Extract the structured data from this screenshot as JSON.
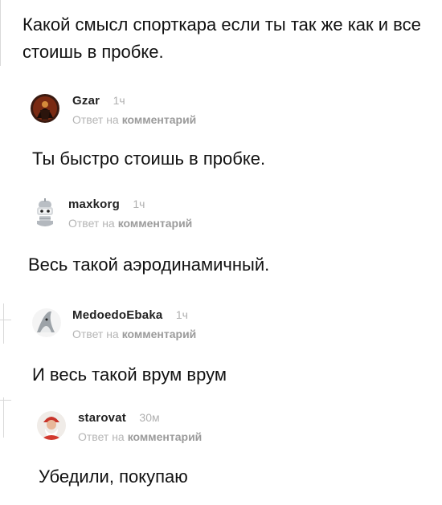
{
  "post": {
    "text": "Какой смысл спорткара если ты так же как и все стоишь в пробке."
  },
  "comments": [
    {
      "username": "Gzar",
      "time": "1ч",
      "reply_prefix": "Ответ на",
      "reply_link": "комментарий",
      "text": "Ты быстро стоишь в пробке."
    },
    {
      "username": "maxkorg",
      "time": "1ч",
      "reply_prefix": "Ответ на",
      "reply_link": "комментарий",
      "text": "Весь такой аэродинамичный."
    },
    {
      "username": "MedoedoEbaka",
      "time": "1ч",
      "reply_prefix": "Ответ на",
      "reply_link": "комментарий",
      "text": "И весь такой врум врум"
    },
    {
      "username": "starovat",
      "time": "30м",
      "reply_prefix": "Ответ на",
      "reply_link": "комментарий",
      "text": "Убедили, покупаю"
    }
  ]
}
